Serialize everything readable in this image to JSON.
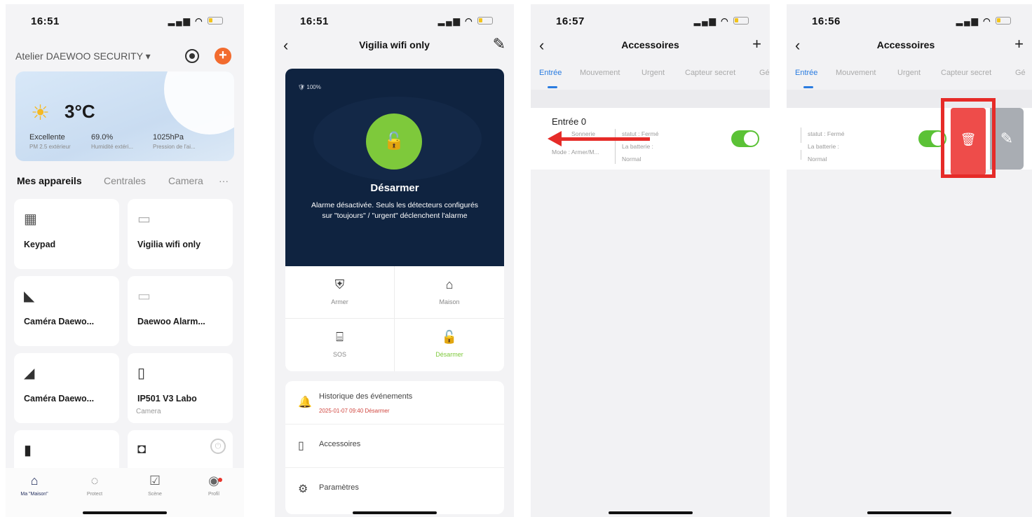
{
  "screen1": {
    "time": "16:51",
    "home_title": "Atelier DAEWOO SECURITY ▾",
    "weather": {
      "temperature": "3°C",
      "stats": [
        {
          "value": "Excellente",
          "label": "PM 2.5 extérieur"
        },
        {
          "value": "69.0%",
          "label": "Humidité extéri..."
        },
        {
          "value": "1025hPa",
          "label": "Pression de l'ai..."
        }
      ]
    },
    "tabs": [
      "Mes appareils",
      "Centrales",
      "Camera",
      "···"
    ],
    "devices": [
      {
        "name": "Keypad",
        "sub": ""
      },
      {
        "name": "Vigilia wifi only",
        "sub": ""
      },
      {
        "name": "Caméra Daewo...",
        "sub": ""
      },
      {
        "name": "Daewoo Alarm...",
        "sub": ""
      },
      {
        "name": "Caméra Daewo...",
        "sub": ""
      },
      {
        "name": "IP501 V3 Labo",
        "sub": "Camera"
      }
    ],
    "tabbar": [
      "Ma \"Maison\"",
      "Protect",
      "Scène",
      "Profil"
    ]
  },
  "screen2": {
    "time": "16:51",
    "title": "Vigilia wifi only",
    "battery": "100%",
    "status": "Désarmer",
    "description": "Alarme désactivée. Seuls les détecteurs configurés sur \"toujours\" / \"urgent\" déclenchent l'alarme",
    "modes": [
      "Armer",
      "Maison",
      "SOS",
      "Désarmer"
    ],
    "menu": [
      {
        "label": "Historique des événements",
        "sub": "2025-01-07 09:40 Désarmer"
      },
      {
        "label": "Accessoires",
        "sub": ""
      },
      {
        "label": "Paramètres",
        "sub": ""
      }
    ]
  },
  "screen3": {
    "time": "16:57",
    "title": "Accessoires",
    "subtabs": [
      "Entrée",
      "Mouvement",
      "Urgent",
      "Capteur secret",
      "Gé"
    ],
    "accessory": {
      "name": "Entrée 0",
      "sonnerie": "Sonnerie",
      "mode": "Mode : Armer/M...",
      "statut": "statut : Fermé",
      "batterie": "La batterie :",
      "batterie_val": "Normal"
    }
  },
  "screen4": {
    "time": "16:56",
    "title": "Accessoires",
    "subtabs": [
      "Entrée",
      "Mouvement",
      "Urgent",
      "Capteur secret",
      "Gé"
    ],
    "accessory": {
      "statut": "statut : Fermé",
      "batterie": "La batterie :",
      "batterie_val": "Normal"
    }
  },
  "colors": {
    "accent_orange": "#f26b2e",
    "panel_navy": "#0f2340",
    "disarm_green": "#7ec93b",
    "toggle_green": "#5bc236",
    "tab_blue": "#2a7ce0",
    "delete_red": "#ee4c4a",
    "highlight_red": "#e62b28"
  }
}
